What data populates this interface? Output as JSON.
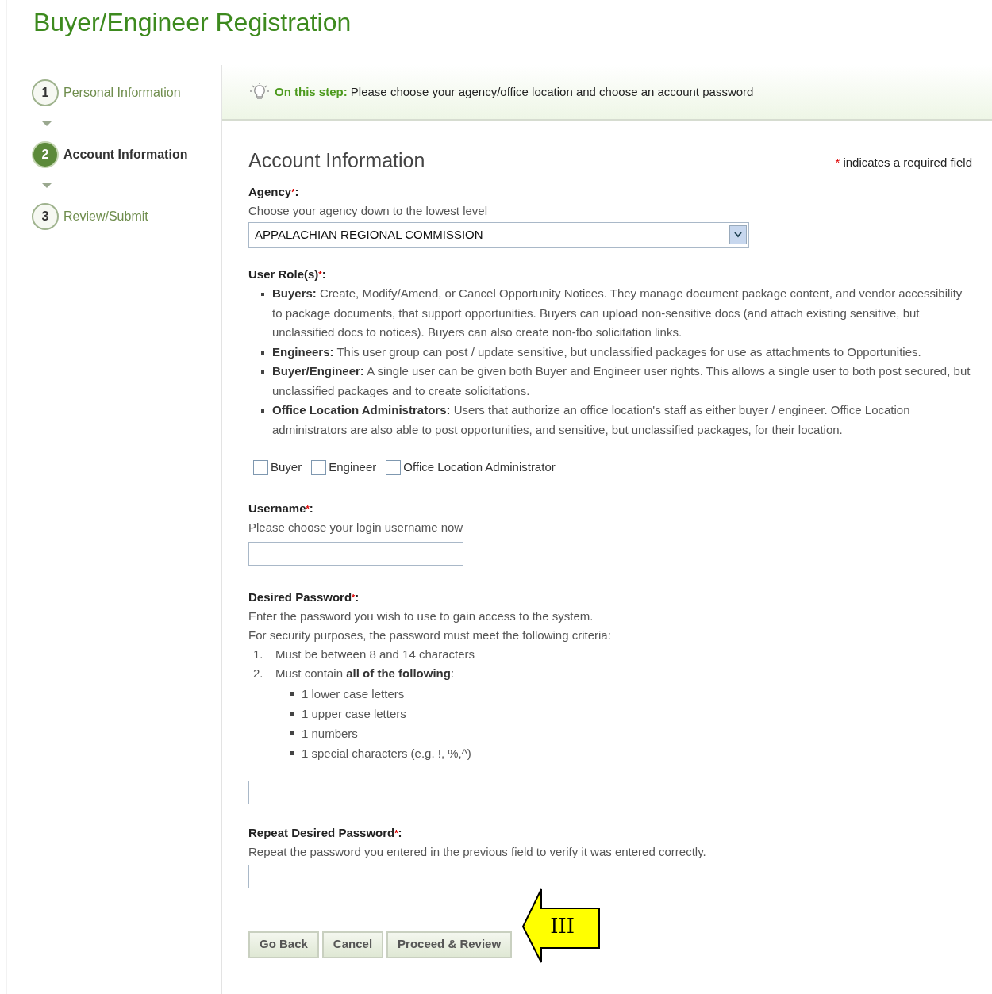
{
  "page_title": "Buyer/Engineer Registration",
  "steps": [
    {
      "number": "1",
      "label": "Personal Information",
      "selected": false
    },
    {
      "number": "2",
      "label": "Account Information",
      "selected": true
    },
    {
      "number": "3",
      "label": "Review/Submit",
      "selected": false
    }
  ],
  "tip": {
    "lead": "On this step:",
    "text": "Please choose your agency/office location and choose an account password"
  },
  "section_title": "Account Information",
  "required_note": {
    "mark": "*",
    "text": "indicates a required field"
  },
  "agency": {
    "label": "Agency",
    "required_mark": "*",
    "suffix": ":",
    "hint": "Choose your agency down to the lowest level",
    "value": "APPALACHIAN REGIONAL COMMISSION"
  },
  "user_roles": {
    "label": "User Role(s)",
    "required_mark": "*",
    "suffix": ":",
    "descriptions": [
      "**Buyers:** Create, Modify/Amend, or Cancel Opportunity Notices. They manage document package content, and vendor accessibility to package documents, that support opportunities. Buyers can upload non-sensitive docs (and attach existing sensitive, but unclassified docs to notices). Buyers can also create non-fbo solicitation links.",
      "**Engineers:** This user group can post / update sensitive, but unclassified packages for use as attachments to Opportunities.",
      "**Buyer/Engineer:** A single user can be given both Buyer and Engineer user rights. This allows a single user to both post secured, but unclassified packages and to create solicitations.",
      "**Office Location Administrators:** Users that authorize an office location's staff as either buyer / engineer. Office Location administrators are also able to post opportunities, and sensitive, but unclassified packages, for their location."
    ],
    "options": [
      {
        "label": "Buyer",
        "checked": false
      },
      {
        "label": "Engineer",
        "checked": false
      },
      {
        "label": "Office Location Administrator",
        "checked": false
      }
    ]
  },
  "username": {
    "label": "Username",
    "required_mark": "*",
    "suffix": ":",
    "hints": [
      "Please choose your login username now"
    ]
  },
  "password": {
    "label": "Desired Password",
    "required_mark": "*",
    "suffix": ":",
    "hints": [
      "Enter the password you wish to use to gain access to the system.",
      "For security purposes, the password must meet the following criteria:"
    ],
    "criteria": [
      {
        "number": "1.",
        "text": "Must be between 8 and 14 characters"
      },
      {
        "number": "2.",
        "text": "Must contain **all of the following**:",
        "children": [
          "1 lower case letters",
          "1 upper case letters",
          "1 numbers",
          "1 special characters (e.g. !, %,^)"
        ]
      }
    ]
  },
  "repeat_password": {
    "label": "Repeat Desired Password",
    "required_mark": "*",
    "suffix": ":",
    "hints": [
      "Repeat the password you entered in the previous field to verify it was entered correctly."
    ]
  },
  "buttons": [
    "Go Back",
    "Cancel",
    "Proceed & Review"
  ],
  "callout": {
    "text": "III"
  }
}
